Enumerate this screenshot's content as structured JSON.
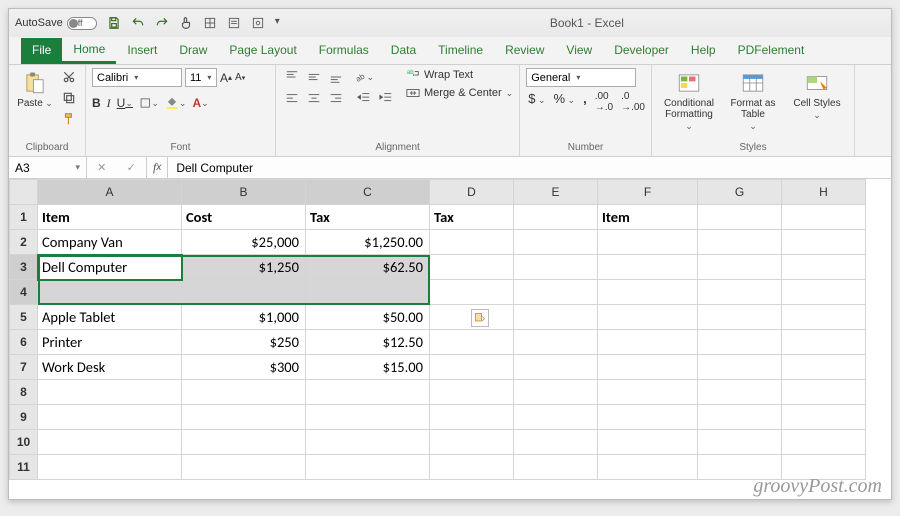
{
  "titlebar": {
    "autosave_label": "AutoSave",
    "autosave_state": "Off",
    "doc_title": "Book1 - Excel"
  },
  "tabs": [
    "File",
    "Home",
    "Insert",
    "Draw",
    "Page Layout",
    "Formulas",
    "Data",
    "Timeline",
    "Review",
    "View",
    "Developer",
    "Help",
    "PDFelement"
  ],
  "active_tab": "Home",
  "ribbon": {
    "clipboard": {
      "paste": "Paste",
      "label": "Clipboard"
    },
    "font": {
      "name": "Calibri",
      "size": "11",
      "bold": "B",
      "italic": "I",
      "underline": "U",
      "label": "Font"
    },
    "alignment": {
      "wrap": "Wrap Text",
      "merge": "Merge & Center",
      "label": "Alignment"
    },
    "number": {
      "format": "General",
      "label": "Number"
    },
    "styles": {
      "cond": "Conditional Formatting",
      "table": "Format as Table",
      "cell": "Cell Styles",
      "label": "Styles"
    }
  },
  "namebox": "A3",
  "formula": "Dell Computer",
  "columns": [
    "A",
    "B",
    "C",
    "D",
    "E",
    "F",
    "G",
    "H"
  ],
  "rows": [
    "1",
    "2",
    "3",
    "4",
    "5",
    "6",
    "7",
    "8",
    "9",
    "10",
    "11"
  ],
  "cells": {
    "A1": "Item",
    "B1": "Cost",
    "C1": "Tax",
    "D1": "Tax",
    "F1": "Item",
    "A2": "Company Van",
    "B2": "$25,000",
    "C2": "$1,250.00",
    "A3": "Dell Computer",
    "B3": "$1,250",
    "C3": "$62.50",
    "A5": "Apple Tablet",
    "B5": "$1,000",
    "C5": "$50.00",
    "A6": "Printer",
    "B6": "$250",
    "C6": "$12.50",
    "A7": "Work Desk",
    "B7": "$300",
    "C7": "$15.00"
  },
  "selected_rows": [
    "3",
    "4"
  ],
  "watermark": "groovyPost.com"
}
